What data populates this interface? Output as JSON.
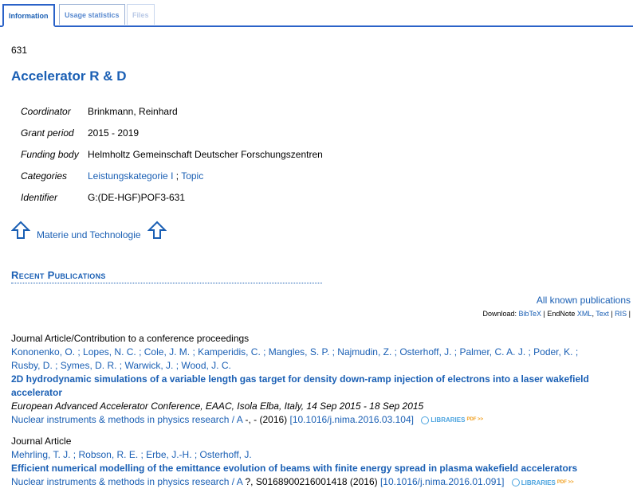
{
  "tabs": [
    {
      "label": "Information"
    },
    {
      "label": "Usage statistics"
    },
    {
      "label": "Files"
    }
  ],
  "record_number": "631",
  "title": "Accelerator R & D",
  "meta": {
    "coordinator_key": "Coordinator",
    "coordinator_val": "Brinkmann, Reinhard",
    "grant_key": "Grant period",
    "grant_val": "2015 - 2019",
    "funding_key": "Funding body",
    "funding_val": "Helmholtz Gemeinschaft Deutscher Forschungszentren",
    "categories_key": "Categories",
    "category1": "Leistungskategorie I",
    "category_sep": " ; ",
    "category2": "Topic",
    "identifier_key": "Identifier",
    "identifier_val": "G:(DE-HGF)POF3-631"
  },
  "parent_link": "Materie und Technologie",
  "recent_heading": "Recent Publications",
  "all_known": "All known publications",
  "download": {
    "prefix": "Download: ",
    "bibtex": "BibTeX",
    "sep1": " | EndNote ",
    "xml": "XML",
    "sep2": ",  ",
    "text": "Text",
    "sep3": " | ",
    "ris": "RIS",
    "sep4": " |"
  },
  "publications": [
    {
      "type": "Journal Article/Contribution to a conference proceedings",
      "authors_line1": "Kononenko, O. ; Lopes, N. C. ; Cole, J. M. ; Kamperidis, C. ; Mangles, S. P. ; Najmudin, Z. ; Osterhoff, J. ; Palmer, C. A. J. ; Poder, K. ;",
      "authors_line2": "Rusby, D. ; Symes, D. R. ; Warwick, J. ; Wood, J. C.",
      "title_line1": "2D hydrodynamic simulations of a variable length gas target for density down-ramp injection of electrons into a laser wakefield",
      "title_line2": "accelerator",
      "event": "European Advanced Accelerator Conference, EAAC, Isola Elba, Italy, 14 Sep 2015 - 18 Sep 2015",
      "journal": "Nuclear instruments & methods in physics research / A",
      "details": " -, - (2016) ",
      "doi": "[10.1016/j.nima.2016.03.104]",
      "lib_label": "LIBRARIES",
      "lib_small": "PDF >>"
    },
    {
      "type": "Journal Article",
      "authors_line1": "Mehrling, T. J. ; Robson, R. E. ; Erbe, J.-H. ; Osterhoff, J.",
      "title_line1": "Efficient numerical modelling of the emittance evolution of beams with finite energy spread in plasma wakefield accelerators",
      "journal": "Nuclear instruments & methods in physics research / A",
      "details": " ?, S0168900216001418 (2016) ",
      "doi": "[10.1016/j.nima.2016.01.091]",
      "lib_label": "LIBRARIES",
      "lib_small": "PDF >>"
    }
  ]
}
